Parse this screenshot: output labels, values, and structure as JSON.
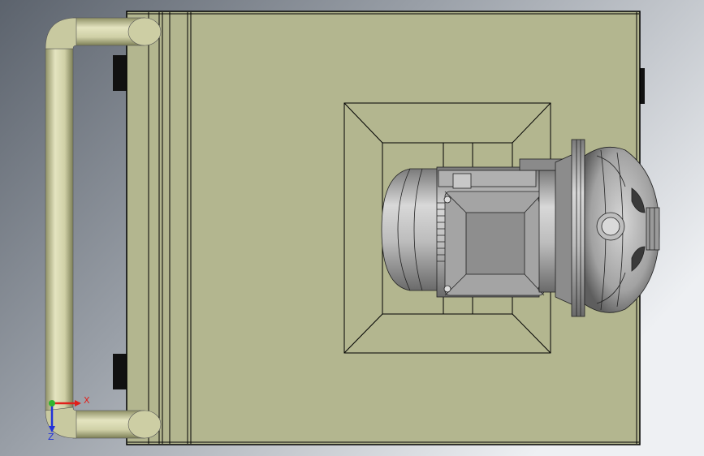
{
  "viewport": {
    "background_top": "#6f7680",
    "background_bottom": "#e6e9ee"
  },
  "model": {
    "body_color": "#b3b68f",
    "body_edge": "#000000",
    "pipe_color": "#d6d6ae",
    "pipe_shade": "#8f9166",
    "motor_color": "#9a9a9a",
    "motor_light": "#d0d0d0",
    "motor_dark": "#5a5a5a",
    "foot_color": "#111111"
  },
  "triad": {
    "x_label": "X",
    "z_label": "Z",
    "x_color": "#e0201b",
    "y_color": "#2fb52f",
    "z_color": "#2232d8"
  }
}
